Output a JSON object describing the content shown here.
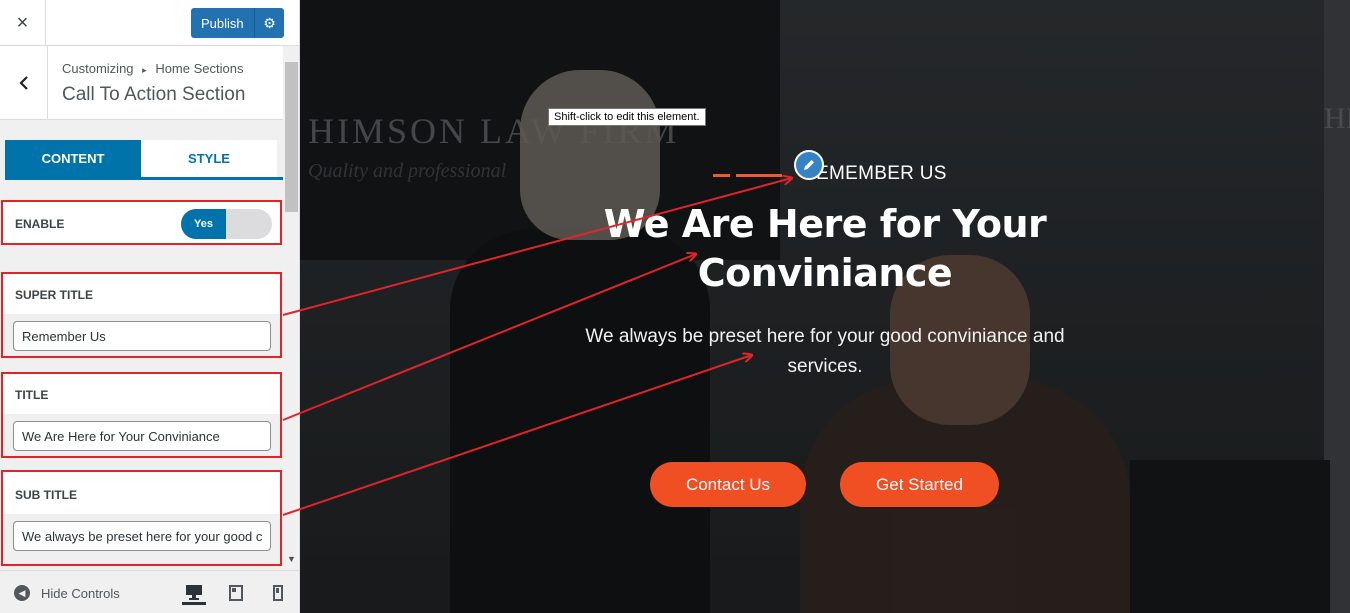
{
  "topbar": {
    "close_icon": "×",
    "publish_label": "Publish",
    "settings_icon": "⚙"
  },
  "section_head": {
    "breadcrumb_root": "Customizing",
    "breadcrumb_sep": "▸",
    "breadcrumb_parent": "Home Sections",
    "title": "Call To Action Section"
  },
  "tabs": [
    {
      "label": "CONTENT",
      "active": true
    },
    {
      "label": "STYLE",
      "active": false
    }
  ],
  "controls": {
    "enable": {
      "label": "ENABLE",
      "toggle_label": "Yes",
      "value": true
    },
    "super_title": {
      "label": "SUPER TITLE",
      "value": "Remember Us"
    },
    "title": {
      "label": "TITLE",
      "value": "We Are Here for Your Conviniance"
    },
    "sub_title": {
      "label": "SUB TITLE",
      "value": "We always be preset here for your good conviniance and services."
    }
  },
  "footer": {
    "hide_controls_label": "Hide Controls",
    "devices": [
      "desktop",
      "tablet",
      "mobile"
    ],
    "active_device": "desktop"
  },
  "preview": {
    "tooltip": "Shift-click to edit this element.",
    "super_title": "REMEMBER US",
    "title_line1": "We Are Here for Your",
    "title_line2": "Conviniance",
    "subtitle_line1": "We always be preset here for your good conviniance and",
    "subtitle_line2": "services.",
    "buttons": [
      {
        "label": "Contact Us"
      },
      {
        "label": "Get Started"
      }
    ],
    "bg_sign_text": "HIMSON LAW FIRM",
    "bg_sign_sub": "Quality and professional",
    "bg_sign_right": "HIM"
  },
  "colors": {
    "wp_blue": "#2271b1",
    "tab_blue": "#0073aa",
    "annotation_red": "#e0242a",
    "accent_orange": "#f04e23"
  }
}
